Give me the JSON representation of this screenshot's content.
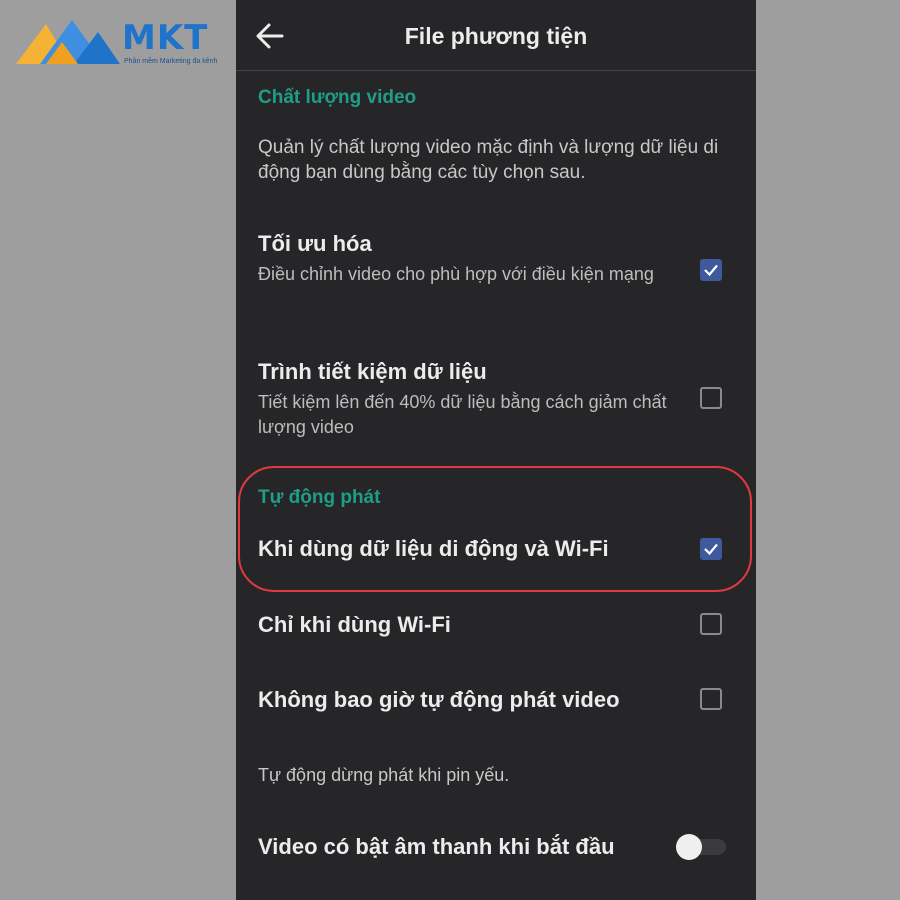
{
  "logo": {
    "brand_text": "MKT",
    "tagline": "Phần mềm Marketing đa kênh",
    "colors": {
      "primary": "#1f73c9",
      "accent": "#f5b335"
    }
  },
  "header": {
    "back_icon": "arrow-left-icon",
    "title": "File phương tiện"
  },
  "video_quality": {
    "section_title": "Chất lượng video",
    "description": "Quản lý chất lượng video mặc định và lượng dữ liệu di động bạn dùng bằng các tùy chọn sau.",
    "options": [
      {
        "title": "Tối ưu hóa",
        "subtitle": "Điều chỉnh video cho phù hợp với điều kiện mạng",
        "checked": true
      },
      {
        "title": "Trình tiết kiệm dữ liệu",
        "subtitle": "Tiết kiệm lên đến 40% dữ liệu bằng cách giảm chất lượng video",
        "checked": false
      }
    ]
  },
  "autoplay": {
    "section_title": "Tự động phát",
    "options": [
      {
        "title": "Khi dùng dữ liệu di động và Wi-Fi",
        "checked": true
      },
      {
        "title": "Chỉ khi dùng Wi-Fi",
        "checked": false
      },
      {
        "title": "Không bao giờ tự động phát video",
        "checked": false
      }
    ],
    "note": "Tự động dừng phát khi pin yếu."
  },
  "sound": {
    "title": "Video có bật âm thanh khi bắt đầu",
    "enabled": false
  },
  "colors": {
    "background": "#262628",
    "section_accent": "#1f9e86",
    "checkbox_checked": "#3f5a9c",
    "highlight": "#e0393f"
  }
}
